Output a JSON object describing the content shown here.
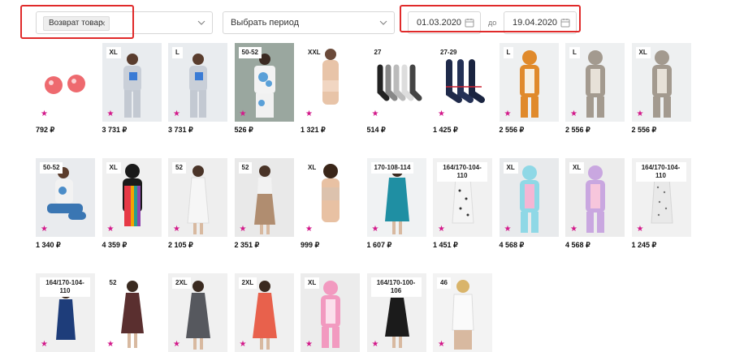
{
  "filters": {
    "type_chip": "Возврат товар",
    "period_label": "Выбрать период",
    "date_from": "01.03.2020",
    "date_separator": "до",
    "date_to": "19.04.2020"
  },
  "colors": {
    "accent_star": "#d3198a",
    "highlight": "#e02a2a"
  },
  "products": [
    {
      "size": "",
      "price": "792 ₽",
      "art": "balls"
    },
    {
      "size": "XL",
      "price": "3 731 ₽",
      "art": "person-light"
    },
    {
      "size": "L",
      "price": "3 731 ₽",
      "art": "person-light"
    },
    {
      "size": "50-52",
      "price": "526 ₽",
      "art": "person-print"
    },
    {
      "size": "XXL",
      "price": "1 321 ₽",
      "art": "bra"
    },
    {
      "size": "27",
      "price": "514 ₽",
      "art": "socks-multi"
    },
    {
      "size": "27-29",
      "price": "1 425 ₽",
      "art": "socks-navy"
    },
    {
      "size": "L",
      "price": "2 556 ₽",
      "art": "kigu-fox"
    },
    {
      "size": "L",
      "price": "2 556 ₽",
      "art": "kigu-grey"
    },
    {
      "size": "XL",
      "price": "2 556 ₽",
      "art": "kigu-grey"
    },
    {
      "size": "50-52",
      "price": "1 340 ₽",
      "art": "person-pajama"
    },
    {
      "size": "XL",
      "price": "4 359 ₽",
      "art": "kigu-rainbow"
    },
    {
      "size": "52",
      "price": "2 105 ₽",
      "art": "dress-white"
    },
    {
      "size": "52",
      "price": "2 351 ₽",
      "art": "dress-beige"
    },
    {
      "size": "XL",
      "price": "999 ₽",
      "art": "bra-woman"
    },
    {
      "size": "170-108-114",
      "price": "1 607 ₽",
      "art": "robe-teal"
    },
    {
      "size": "164/170-104-110",
      "price": "1 451 ₽",
      "art": "dress-floral"
    },
    {
      "size": "XL",
      "price": "4 568 ₽",
      "art": "kigu-unicorn"
    },
    {
      "size": "XL",
      "price": "4 568 ₽",
      "art": "kigu-unicorn2"
    },
    {
      "size": "164/170-104-110",
      "price": "1 245 ₽",
      "art": "dress-dots"
    },
    {
      "size": "164/170-104-110",
      "price": "",
      "art": "dress-navy"
    },
    {
      "size": "52",
      "price": "",
      "art": "dress-maroon"
    },
    {
      "size": "2XL",
      "price": "",
      "art": "dress-grey"
    },
    {
      "size": "2XL",
      "price": "",
      "art": "dress-coral"
    },
    {
      "size": "XL",
      "price": "",
      "art": "kigu-pink"
    },
    {
      "size": "164/170-100-106",
      "price": "",
      "art": "dress-black"
    },
    {
      "size": "46",
      "price": "",
      "art": "blouse-white"
    }
  ]
}
